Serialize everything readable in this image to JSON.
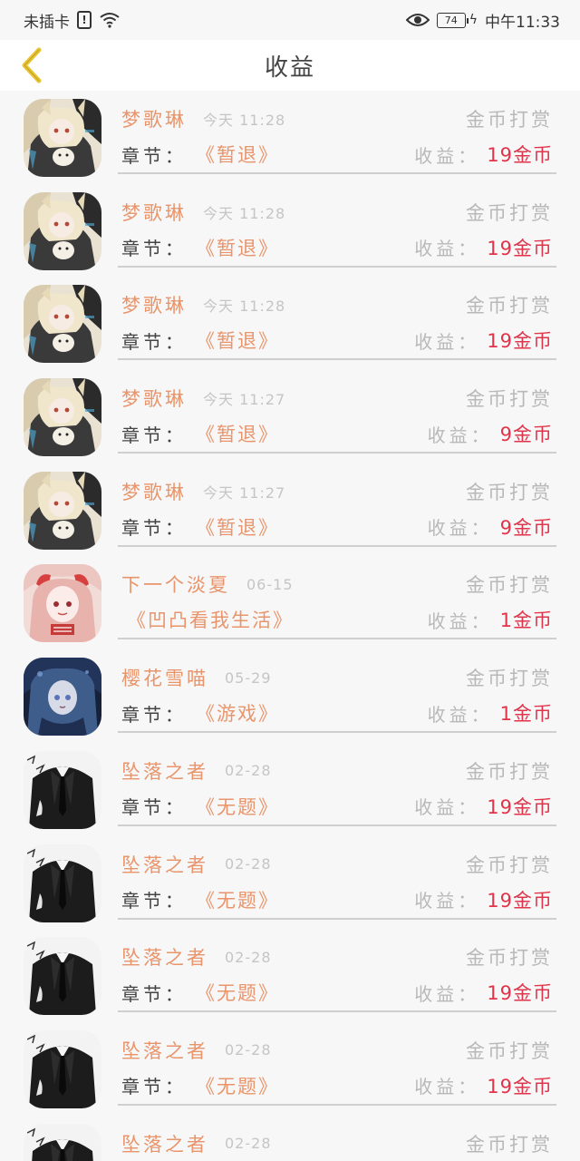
{
  "status_bar": {
    "carrier": "未插卡",
    "battery": "74",
    "time": "中午11:33"
  },
  "header": {
    "title": "收益"
  },
  "labels": {
    "reward_type": "金币打赏",
    "chapter_label": "章节：",
    "earn_label": "收益："
  },
  "rows": [
    {
      "name": "梦歌琳",
      "time": "今天 11:28",
      "chapter": "《暂退》",
      "earning": "19金币",
      "avatar": "fox-girl"
    },
    {
      "name": "梦歌琳",
      "time": "今天 11:28",
      "chapter": "《暂退》",
      "earning": "19金币",
      "avatar": "fox-girl"
    },
    {
      "name": "梦歌琳",
      "time": "今天 11:28",
      "chapter": "《暂退》",
      "earning": "19金币",
      "avatar": "fox-girl"
    },
    {
      "name": "梦歌琳",
      "time": "今天 11:27",
      "chapter": "《暂退》",
      "earning": "9金币",
      "avatar": "fox-girl"
    },
    {
      "name": "梦歌琳",
      "time": "今天 11:27",
      "chapter": "《暂退》",
      "earning": "9金币",
      "avatar": "fox-girl"
    },
    {
      "name": "下一个淡夏",
      "time": "06-15",
      "chapter": "《凹凸看我生活》",
      "earning": "1金币",
      "avatar": "pink-girl",
      "no_prefix": true
    },
    {
      "name": "樱花雪喵",
      "time": "05-29",
      "chapter": "《游戏》",
      "earning": "1金币",
      "avatar": "blue-girl"
    },
    {
      "name": "坠落之者",
      "time": "02-28",
      "chapter": "《无题》",
      "earning": "19金币",
      "avatar": "suit-man"
    },
    {
      "name": "坠落之者",
      "time": "02-28",
      "chapter": "《无题》",
      "earning": "19金币",
      "avatar": "suit-man"
    },
    {
      "name": "坠落之者",
      "time": "02-28",
      "chapter": "《无题》",
      "earning": "19金币",
      "avatar": "suit-man"
    },
    {
      "name": "坠落之者",
      "time": "02-28",
      "chapter": "《无题》",
      "earning": "19金币",
      "avatar": "suit-man"
    },
    {
      "name": "坠落之者",
      "time": "02-28",
      "chapter": "",
      "earning": "",
      "avatar": "suit-man",
      "partial": true
    }
  ],
  "colors": {
    "name": "#e8956b",
    "earning": "#e0344a",
    "muted": "#b8b8b8",
    "back_arrow": "#e9c534"
  }
}
